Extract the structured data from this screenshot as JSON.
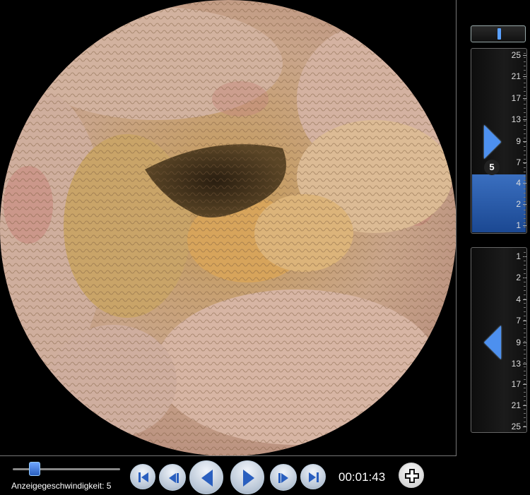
{
  "viewer": {
    "image": "endoscopic-tissue-view"
  },
  "colors": {
    "accent": "#4d90ef",
    "highlight": "#2b5fae",
    "background": "#000000"
  },
  "forward_scale": {
    "labels": [
      "25",
      "21",
      "17",
      "13",
      "9",
      "7",
      "4",
      "2",
      "1"
    ],
    "current_speed": "5",
    "arrow_icon": "play-forward-icon"
  },
  "reverse_scale": {
    "labels": [
      "1",
      "2",
      "4",
      "7",
      "9",
      "13",
      "17",
      "21",
      "25"
    ],
    "arrow_icon": "play-reverse-icon"
  },
  "controls": {
    "speed_label": "Anzeigegeschwindigkeit: 5",
    "speed_value": 5,
    "time": "00:01:43",
    "buttons": [
      "skip-to-start-icon",
      "step-back-icon",
      "play-reverse-icon",
      "play-forward-icon",
      "step-forward-icon",
      "skip-to-end-icon",
      "zoom-plus-icon"
    ]
  }
}
